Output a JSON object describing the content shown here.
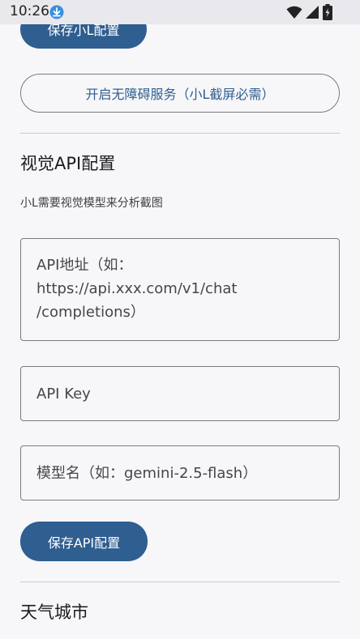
{
  "status_bar": {
    "time": "10:26",
    "icons": [
      "download-icon",
      "wifi-icon",
      "signal-icon",
      "battery-charging-icon"
    ]
  },
  "buttons": {
    "save_xiaol_label": "保存小L配置",
    "accessibility_label": "开启无障碍服务（小L截屏必需）",
    "save_api_label": "保存API配置"
  },
  "vision_api": {
    "title": "视觉API配置",
    "hint": "小L需要视觉模型来分析截图",
    "api_url_placeholder": "API地址（如：\nhttps://api.xxx.com/v1/chat\n/completions）",
    "api_key_placeholder": "API Key",
    "model_placeholder": "模型名（如：gemini-2.5-flash）"
  },
  "weather": {
    "title": "天气城市"
  },
  "colors": {
    "primary": "#2f5e90",
    "background": "#f7f7f9",
    "outline": "#777a80",
    "divider": "#cacbd0"
  }
}
